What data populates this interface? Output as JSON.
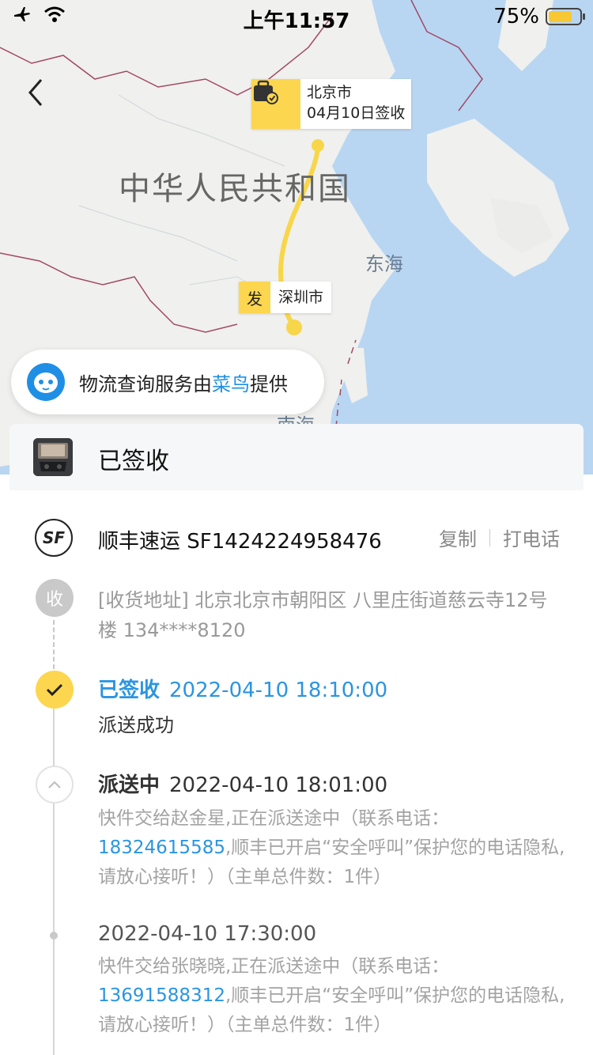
{
  "status_bar": {
    "time": "上午11:57",
    "battery": "75%"
  },
  "map": {
    "country_label": "中华人民共和国",
    "sea_east": "东海",
    "sea_south": "南海",
    "destination": {
      "city": "北京市",
      "status": "04月10日签收"
    },
    "origin": {
      "tag": "发",
      "city": "深圳市"
    }
  },
  "provider": {
    "prefix": "物流查询服务由",
    "name": "菜鸟",
    "suffix": "提供"
  },
  "header": {
    "status": "已签收"
  },
  "shipment": {
    "carrier_logo": "SF",
    "carrier_name": "顺丰速运",
    "tracking_number": "SF1424224958476",
    "copy_label": "复制",
    "call_label": "打电话"
  },
  "address": {
    "icon_label": "收",
    "text": "[收货地址] 北京北京市朝阳区 八里庄街道慈云寺12号楼 134****8120"
  },
  "timeline": [
    {
      "title": "已签收",
      "time": "2022-04-10 18:10:00",
      "desc": "派送成功"
    },
    {
      "title": "派送中",
      "time": "2022-04-10 18:01:00",
      "desc_before": "快件交给赵金星,正在派送途中（联系电话：",
      "phone": "18324615585",
      "desc_after": ",顺丰已开启“安全呼叫”保护您的电话隐私,请放心接听！）（主单总件数：1件）"
    },
    {
      "title": "",
      "time": "2022-04-10 17:30:00",
      "desc_before": "快件交给张晓晓,正在派送途中（联系电话：",
      "phone": "13691588312",
      "desc_after": ",顺丰已开启“安全呼叫”保护您的电话隐私,请放心接听！）（主单总件数：1件）"
    }
  ],
  "colors": {
    "accent_yellow": "#fcd64f",
    "link_blue": "#2b95e0",
    "sea": "#b8d6f2"
  }
}
